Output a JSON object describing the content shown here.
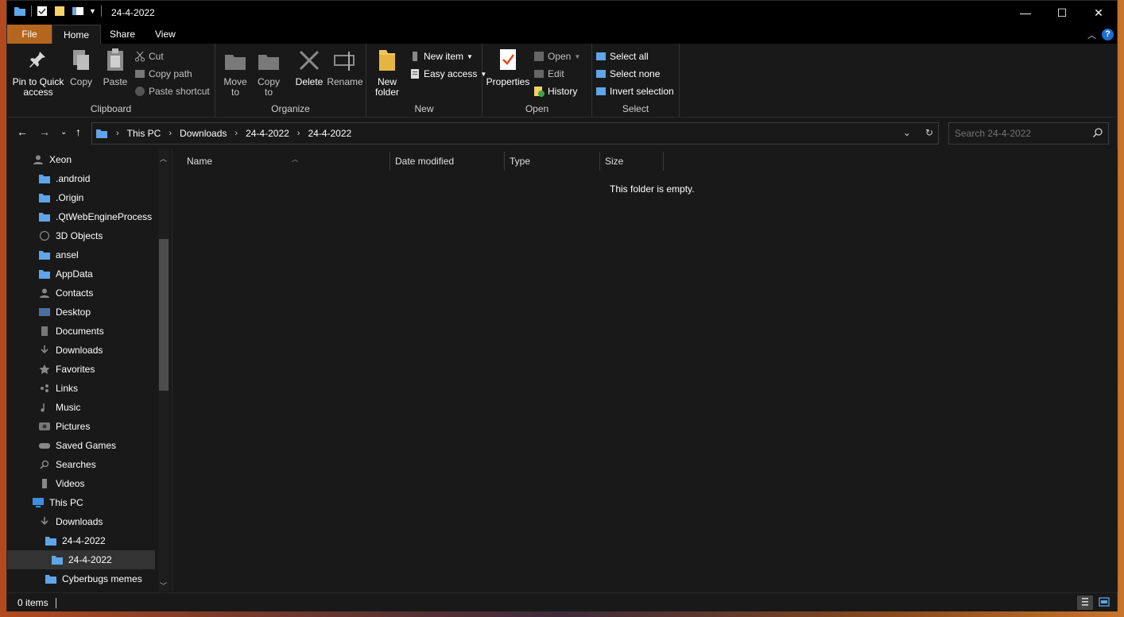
{
  "window": {
    "title": "24-4-2022",
    "minimize_glyph": "—",
    "maximize_glyph": "☐",
    "close_glyph": "✕"
  },
  "ribbon_tabs": [
    "File",
    "Home",
    "Share",
    "View"
  ],
  "ribbon": {
    "clipboard": {
      "label": "Clipboard",
      "pin_label": "Pin to Quick access",
      "copy_label": "Copy",
      "paste_label": "Paste",
      "cut_label": "Cut",
      "copy_path_label": "Copy path",
      "paste_shortcut_label": "Paste shortcut"
    },
    "organize": {
      "label": "Organize",
      "move_to_label": "Move to",
      "copy_to_label": "Copy to",
      "delete_label": "Delete",
      "rename_label": "Rename"
    },
    "new": {
      "label": "New",
      "new_folder_label": "New folder",
      "new_item_label": "New item",
      "easy_access_label": "Easy access"
    },
    "open": {
      "label": "Open",
      "properties_label": "Properties",
      "open_label": "Open",
      "edit_label": "Edit",
      "history_label": "History"
    },
    "select": {
      "label": "Select",
      "select_all_label": "Select all",
      "select_none_label": "Select none",
      "invert_selection_label": "Invert selection"
    }
  },
  "address": {
    "crumbs": [
      "This PC",
      "Downloads",
      "24-4-2022",
      "24-4-2022"
    ]
  },
  "search": {
    "placeholder": "Search 24-4-2022"
  },
  "sidebar": {
    "items": [
      {
        "label": "Xeon",
        "icon": "user-icon"
      },
      {
        "label": ".android",
        "icon": "folder-icon"
      },
      {
        "label": ".Origin",
        "icon": "folder-icon"
      },
      {
        "label": ".QtWebEngineProcess",
        "icon": "folder-icon"
      },
      {
        "label": "3D Objects",
        "icon": "3d-objects-icon"
      },
      {
        "label": "ansel",
        "icon": "folder-icon"
      },
      {
        "label": "AppData",
        "icon": "folder-icon"
      },
      {
        "label": "Contacts",
        "icon": "contacts-icon"
      },
      {
        "label": "Desktop",
        "icon": "desktop-icon"
      },
      {
        "label": "Documents",
        "icon": "documents-icon"
      },
      {
        "label": "Downloads",
        "icon": "download-icon"
      },
      {
        "label": "Favorites",
        "icon": "star-icon"
      },
      {
        "label": "Links",
        "icon": "links-icon"
      },
      {
        "label": "Music",
        "icon": "music-icon"
      },
      {
        "label": "Pictures",
        "icon": "pictures-icon"
      },
      {
        "label": "Saved Games",
        "icon": "gamepad-icon"
      },
      {
        "label": "Searches",
        "icon": "search-icon"
      },
      {
        "label": "Videos",
        "icon": "videos-icon"
      },
      {
        "label": "This PC",
        "icon": "computer-icon"
      },
      {
        "label": "Downloads",
        "icon": "download-icon"
      },
      {
        "label": "24-4-2022",
        "icon": "folder-icon"
      },
      {
        "label": "24-4-2022",
        "icon": "folder-icon"
      },
      {
        "label": "Cyberbugs memes",
        "icon": "folder-icon"
      }
    ]
  },
  "columns": [
    "Name",
    "Date modified",
    "Type",
    "Size"
  ],
  "content": {
    "empty_message": "This folder is empty."
  },
  "status": {
    "item_count": "0 items"
  },
  "colors": {
    "file_tab": "#b4661e",
    "folder": "#dcb95a",
    "folder_blue": "#5fa5e8",
    "background": "#191919",
    "help": "#1f6fd1"
  }
}
